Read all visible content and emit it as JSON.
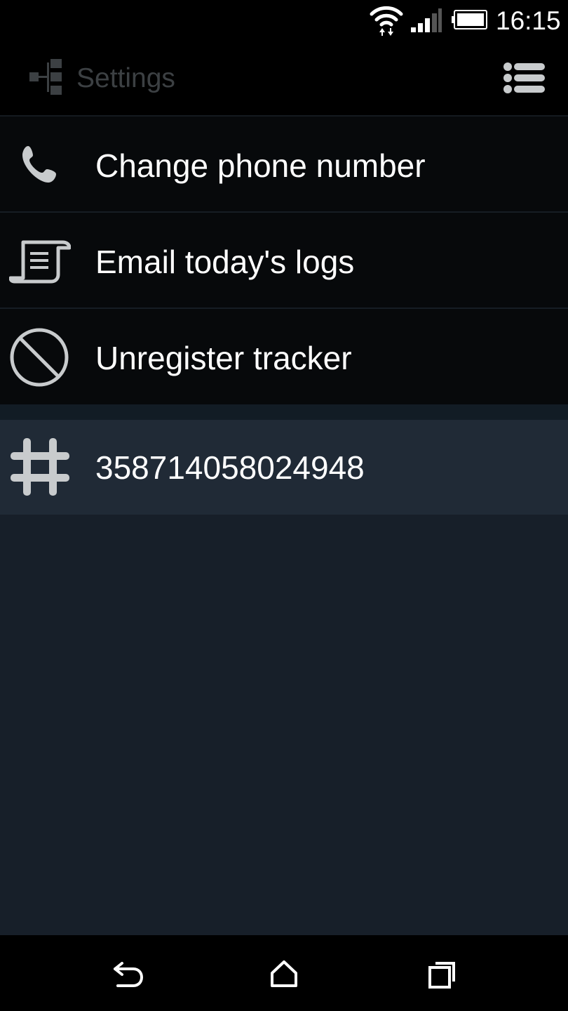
{
  "status_bar": {
    "time": "16:15",
    "icons": [
      "wifi-icon",
      "cell-signal-icon",
      "battery-icon"
    ]
  },
  "action_bar": {
    "title": "Settings",
    "app_icon": "hierarchy-icon",
    "menu_icon": "list-menu-icon"
  },
  "settings_items": [
    {
      "label": "Change phone number",
      "icon": "phone-icon"
    },
    {
      "label": "Email today's logs",
      "icon": "scroll-log-icon"
    },
    {
      "label": "Unregister tracker",
      "icon": "prohibited-icon"
    }
  ],
  "device_id": {
    "value": "358714058024948",
    "icon": "hash-icon"
  },
  "nav_bar": {
    "buttons": [
      "back-icon",
      "home-icon",
      "recent-apps-icon"
    ]
  },
  "colors": {
    "title_dimmed": "#3c4043",
    "list_background": "#07090b",
    "selected_row": "#202a36",
    "content_background": "#171f29",
    "icon_gray": "#c8cbcd"
  }
}
